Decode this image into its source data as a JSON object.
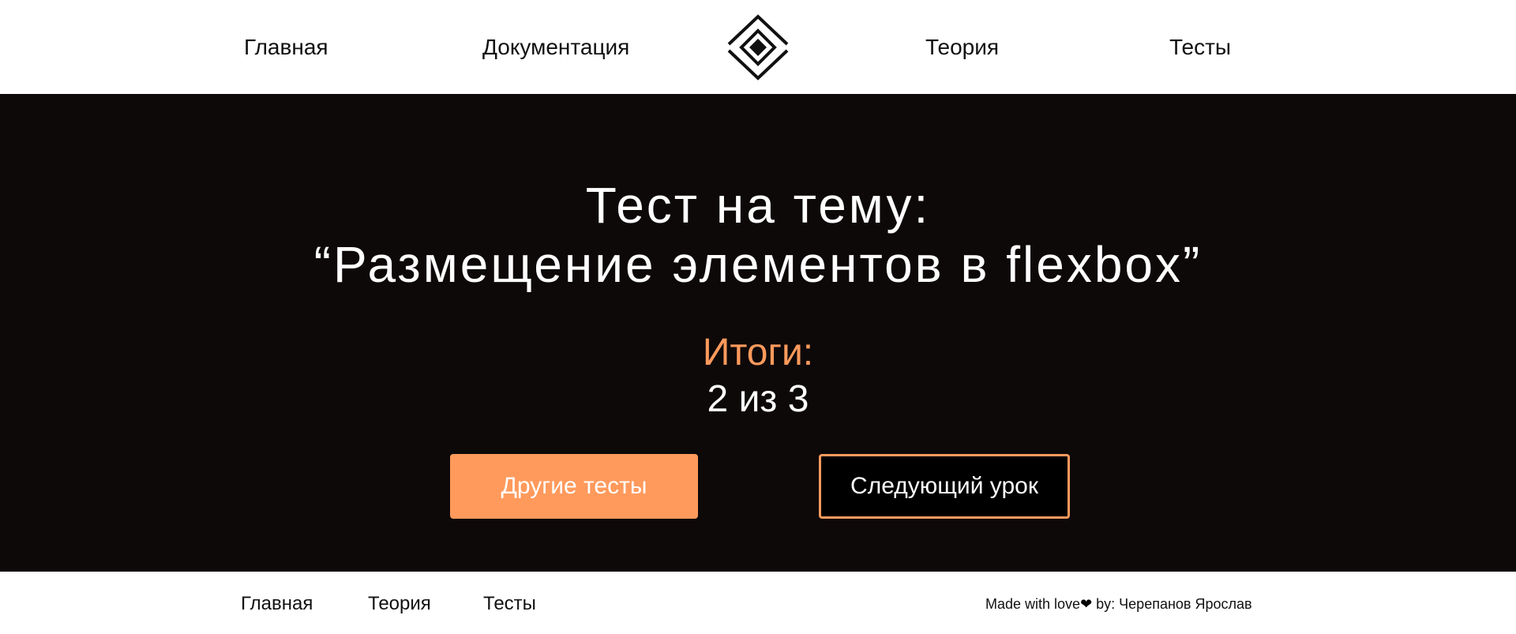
{
  "header": {
    "nav": {
      "home": "Главная",
      "docs": "Документация",
      "theory": "Теория",
      "tests": "Тесты"
    },
    "logo_icon": "diamond-logo-icon"
  },
  "hero": {
    "title_line1": "Тест на тему:",
    "title_line2": "“Размещение элементов в flexbox”",
    "results_label": "Итоги:",
    "results_score": "2 из 3",
    "buttons": {
      "other_tests": "Другие тесты",
      "next_lesson": "Следующий урок"
    }
  },
  "footer": {
    "nav": {
      "home": "Главная",
      "theory": "Теория",
      "tests": "Тесты"
    },
    "credits": {
      "prefix": "Made with love",
      "heart": "❤",
      "suffix": " by: Черепанов Ярослав"
    }
  },
  "colors": {
    "accent": "#ff9a5c",
    "hero_background": "#0e0909",
    "page_background": "#ffffff",
    "text_dark": "#111111",
    "text_light": "#ffffff"
  }
}
